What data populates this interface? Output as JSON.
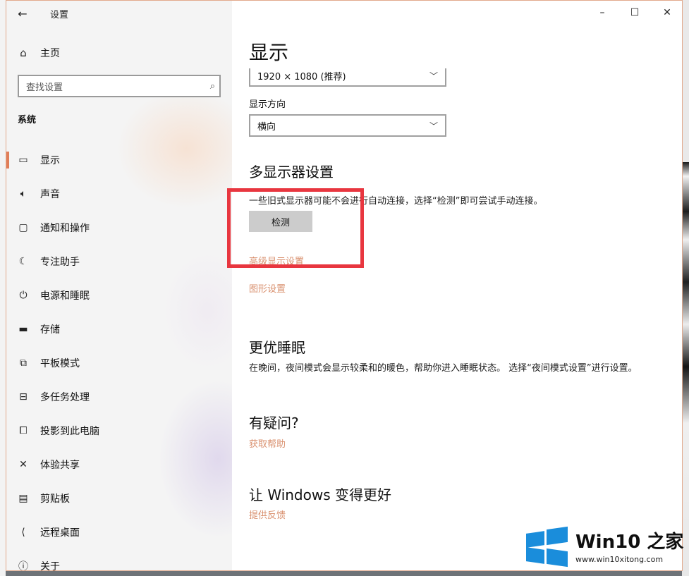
{
  "window": {
    "app_title": "设置",
    "controls": {
      "minimize": "–",
      "maximize": "☐",
      "close": "✕"
    }
  },
  "sidebar": {
    "back_icon": "back-arrow-icon",
    "home_label": "主页",
    "search_placeholder": "查找设置",
    "section_title": "系统",
    "items": [
      {
        "label": "显示",
        "icon": "monitor-icon",
        "active": true
      },
      {
        "label": "声音",
        "icon": "speaker-icon"
      },
      {
        "label": "通知和操作",
        "icon": "notification-icon"
      },
      {
        "label": "专注助手",
        "icon": "moon-icon"
      },
      {
        "label": "电源和睡眠",
        "icon": "power-icon"
      },
      {
        "label": "存储",
        "icon": "storage-icon"
      },
      {
        "label": "平板模式",
        "icon": "tablet-icon"
      },
      {
        "label": "多任务处理",
        "icon": "multitask-icon"
      },
      {
        "label": "投影到此电脑",
        "icon": "project-icon"
      },
      {
        "label": "体验共享",
        "icon": "share-icon"
      },
      {
        "label": "剪贴板",
        "icon": "clipboard-icon"
      },
      {
        "label": "远程桌面",
        "icon": "remote-icon"
      },
      {
        "label": "关于",
        "icon": "info-icon"
      }
    ]
  },
  "main": {
    "title": "显示",
    "resolution_value": "1920 × 1080 (推荐)",
    "orientation_label": "显示方向",
    "orientation_value": "横向",
    "multi_display": {
      "heading": "多显示器设置",
      "description": "一些旧式显示器可能不会进行自动连接，选择“检测”即可尝试手动连接。",
      "detect_button": "检测",
      "advanced_link": "高级显示设置",
      "graphics_link": "图形设置"
    },
    "sleep": {
      "heading": "更优睡眠",
      "description": "在晚间，夜间模式会显示较柔和的暖色，帮助你进入睡眠状态。 选择“夜间模式设置”进行设置。"
    },
    "questions": {
      "heading": "有疑问?",
      "link": "获取帮助"
    },
    "improve": {
      "heading": "让 Windows 变得更好",
      "link": "提供反馈"
    }
  },
  "watermark": {
    "title_latin": "Win10",
    "title_zh": "之家",
    "url": "www.win10xitong.com"
  },
  "colors": {
    "accent": "#e07e59",
    "link": "#d9906e",
    "highlight": "#e8363f",
    "logo_blue": "#1a8ddb"
  }
}
